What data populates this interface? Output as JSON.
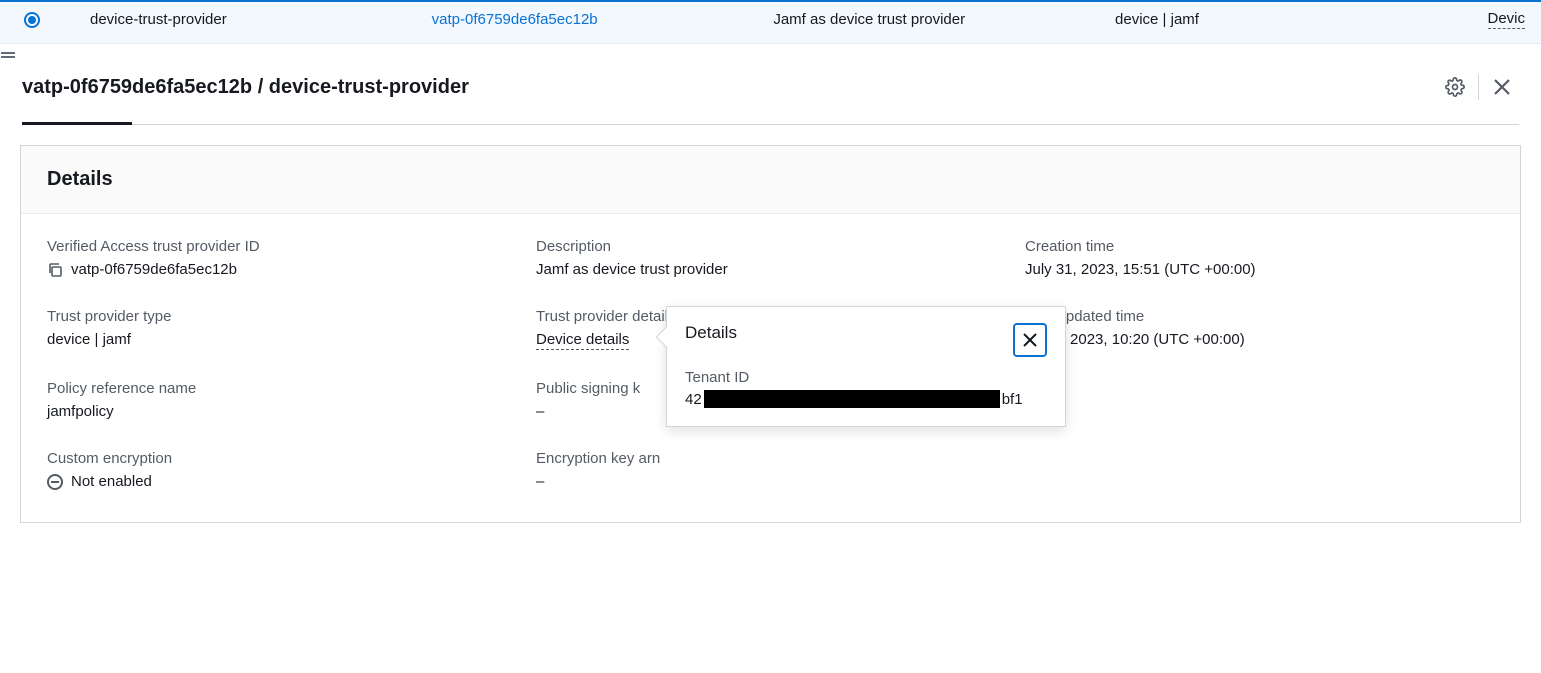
{
  "row": {
    "name": "device-trust-provider",
    "id": "vatp-0f6759de6fa5ec12b",
    "description": "Jamf as device trust provider",
    "type": "device | jamf",
    "lastColPrefix": "Devic"
  },
  "header": {
    "title": "vatp-0f6759de6fa5ec12b / device-trust-provider"
  },
  "card": {
    "title": "Details"
  },
  "fields": {
    "id_label": "Verified Access trust provider ID",
    "id_value": "vatp-0f6759de6fa5ec12b",
    "description_label": "Description",
    "description_value": "Jamf as device trust provider",
    "creation_label": "Creation time",
    "creation_value": "July 31, 2023, 15:51 (UTC +00:00)",
    "type_label": "Trust provider type",
    "type_value": "device | jamf",
    "details_label": "Trust provider details",
    "details_value": "Device details",
    "updated_label": "Last updated time",
    "updated_value": "August 08, 2023, 10:20 (UTC +00:00)",
    "updated_value_visible": "ıst 08, 2023, 10:20 (UTC +00:00)",
    "policy_label": "Policy reference name",
    "policy_value": "jamfpolicy",
    "signkey_label": "Public signing k",
    "signkey_value": "–",
    "custom_enc_label": "Custom encryption",
    "custom_enc_value": "Not enabled",
    "enc_arn_label": "Encryption key arn",
    "enc_arn_value": "–"
  },
  "popover": {
    "title": "Details",
    "tenant_label": "Tenant ID",
    "tenant_prefix": "42",
    "tenant_suffix": "bf1"
  }
}
